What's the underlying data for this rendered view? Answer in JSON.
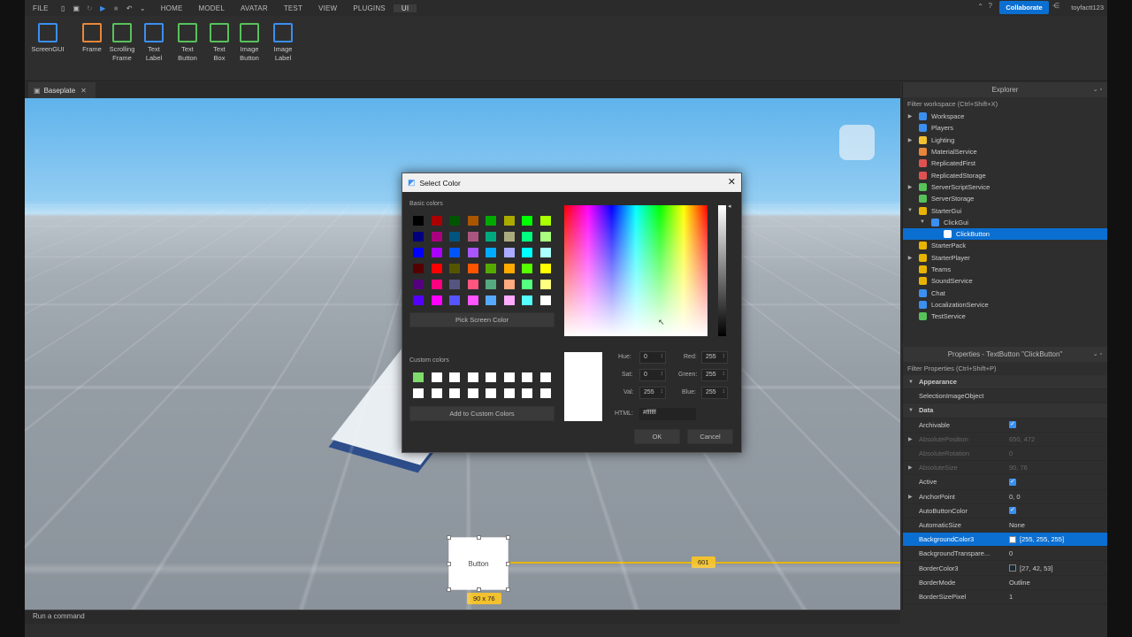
{
  "menu": {
    "file": "FILE",
    "tabs": [
      "HOME",
      "MODEL",
      "AVATAR",
      "TEST",
      "VIEW",
      "PLUGINS",
      "UI"
    ],
    "collaborate": "Collaborate",
    "username": "toyfactt123"
  },
  "ribbon": [
    {
      "label": "ScreenGUI",
      "icon": "screengui-icon",
      "color": "#3a8ff0"
    },
    {
      "label": "Frame",
      "icon": "frame-icon",
      "color": "#e8873a"
    },
    {
      "label": "Scrolling\nFrame",
      "icon": "scrolling-frame-icon",
      "color": "#57c25a"
    },
    {
      "label": "Text\nLabel",
      "icon": "text-label-icon",
      "color": "#3a8ff0"
    },
    {
      "label": "Text\nButton",
      "icon": "text-button-icon",
      "color": "#57c25a"
    },
    {
      "label": "Text\nBox",
      "icon": "text-box-icon",
      "color": "#57c25a"
    },
    {
      "label": "Image\nButton",
      "icon": "image-button-icon",
      "color": "#57c25a"
    },
    {
      "label": "Image\nLabel",
      "icon": "image-label-icon",
      "color": "#3a8ff0"
    }
  ],
  "doc_tab": {
    "label": "Baseplate"
  },
  "viewport": {
    "button_text": "Button",
    "size_tag": "90 x 76",
    "distance_tag": "601"
  },
  "command_bar": {
    "placeholder": "Run a command"
  },
  "explorer": {
    "title": "Explorer",
    "filter": "Filter workspace (Ctrl+Shift+X)",
    "items": [
      {
        "label": "Workspace",
        "color": "#3a8ff0",
        "arrow": "▶"
      },
      {
        "label": "Players",
        "color": "#3a8ff0",
        "arrow": ""
      },
      {
        "label": "Lighting",
        "color": "#f2c12e",
        "arrow": "▶"
      },
      {
        "label": "MaterialService",
        "color": "#e8873a",
        "arrow": ""
      },
      {
        "label": "ReplicatedFirst",
        "color": "#e05252",
        "arrow": ""
      },
      {
        "label": "ReplicatedStorage",
        "color": "#e05252",
        "arrow": ""
      },
      {
        "label": "ServerScriptService",
        "color": "#57c25a",
        "arrow": "▶"
      },
      {
        "label": "ServerStorage",
        "color": "#57c25a",
        "arrow": ""
      },
      {
        "label": "StarterGui",
        "color": "#e8b400",
        "arrow": "▼"
      },
      {
        "label": "ClickGui",
        "color": "#3a8ff0",
        "arrow": "▼",
        "indent": 1
      },
      {
        "label": "ClickButton",
        "color": "#ffffff",
        "arrow": "",
        "indent": 2,
        "selected": true
      },
      {
        "label": "StarterPack",
        "color": "#e8b400",
        "arrow": ""
      },
      {
        "label": "StarterPlayer",
        "color": "#e8b400",
        "arrow": "▶"
      },
      {
        "label": "Teams",
        "color": "#e8b400",
        "arrow": ""
      },
      {
        "label": "SoundService",
        "color": "#e8b400",
        "arrow": ""
      },
      {
        "label": "Chat",
        "color": "#3a8ff0",
        "arrow": ""
      },
      {
        "label": "LocalizationService",
        "color": "#3a8ff0",
        "arrow": ""
      },
      {
        "label": "TestService",
        "color": "#57c25a",
        "arrow": ""
      }
    ]
  },
  "properties": {
    "title": "Properties - TextButton \"ClickButton\"",
    "filter": "Filter Properties (Ctrl+Shift+P)",
    "rows": [
      {
        "name": "Appearance",
        "cat": true,
        "arrow": "▼"
      },
      {
        "name": "SelectionImageObject",
        "value": ""
      },
      {
        "name": "Data",
        "cat": true,
        "arrow": "▼"
      },
      {
        "name": "Archivable",
        "check": true
      },
      {
        "name": "AbsolutePosition",
        "value": "650, 472",
        "dim": true,
        "arrow": "▶"
      },
      {
        "name": "AbsoluteRotation",
        "value": "0",
        "dim": true
      },
      {
        "name": "AbsoluteSize",
        "value": "90, 76",
        "dim": true,
        "arrow": "▶"
      },
      {
        "name": "Active",
        "check": true
      },
      {
        "name": "AnchorPoint",
        "value": "0, 0",
        "arrow": "▶"
      },
      {
        "name": "AutoButtonColor",
        "check": true
      },
      {
        "name": "AutomaticSize",
        "value": "None"
      },
      {
        "name": "BackgroundColor3",
        "value": "[255, 255, 255]",
        "swatch": "#ffffff",
        "selected": true
      },
      {
        "name": "BackgroundTranspare...",
        "value": "0"
      },
      {
        "name": "BorderColor3",
        "value": "[27, 42, 53]",
        "swatch": "#1b2a35"
      },
      {
        "name": "BorderMode",
        "value": "Outline"
      },
      {
        "name": "BorderSizePixel",
        "value": "1"
      }
    ]
  },
  "dialog": {
    "title": "Select Color",
    "basic_label": "Basic colors",
    "pick_screen": "Pick Screen Color",
    "custom_label": "Custom colors",
    "add_custom": "Add to Custom Colors",
    "hue_label": "Hue:",
    "hue": "0",
    "sat_label": "Sat:",
    "sat": "0",
    "val_label": "Val:",
    "val": "255",
    "red_label": "Red:",
    "red": "255",
    "green_label": "Green:",
    "green": "255",
    "blue_label": "Blue:",
    "blue": "255",
    "html_label": "HTML:",
    "html": "#ffffff",
    "ok": "OK",
    "cancel": "Cancel",
    "basic_colors": [
      "#000000",
      "#aa0000",
      "#005500",
      "#aa5500",
      "#00aa00",
      "#aaaa00",
      "#00ff00",
      "#aaff00",
      "#00007f",
      "#aa007f",
      "#00557f",
      "#aa557f",
      "#00aa7f",
      "#aaaa7f",
      "#00ff7f",
      "#aaff7f",
      "#0000ff",
      "#aa00ff",
      "#0055ff",
      "#aa55ff",
      "#00aaff",
      "#aaaaff",
      "#00ffff",
      "#aaffff",
      "#550000",
      "#ff0000",
      "#555500",
      "#ff5500",
      "#55aa00",
      "#ffaa00",
      "#55ff00",
      "#ffff00",
      "#55007f",
      "#ff007f",
      "#55557f",
      "#ff557f",
      "#55aa7f",
      "#ffaa7f",
      "#55ff7f",
      "#ffff7f",
      "#5500ff",
      "#ff00ff",
      "#5555ff",
      "#ff55ff",
      "#55aaff",
      "#ffaaff",
      "#55ffff",
      "#ffffff"
    ],
    "custom_colors": [
      "#7fdc6b",
      "#ffffff",
      "#ffffff",
      "#ffffff",
      "#ffffff",
      "#ffffff",
      "#ffffff",
      "#ffffff",
      "#ffffff",
      "#ffffff",
      "#ffffff",
      "#ffffff",
      "#ffffff",
      "#ffffff",
      "#ffffff",
      "#ffffff"
    ],
    "current_color": "#ffffff"
  }
}
